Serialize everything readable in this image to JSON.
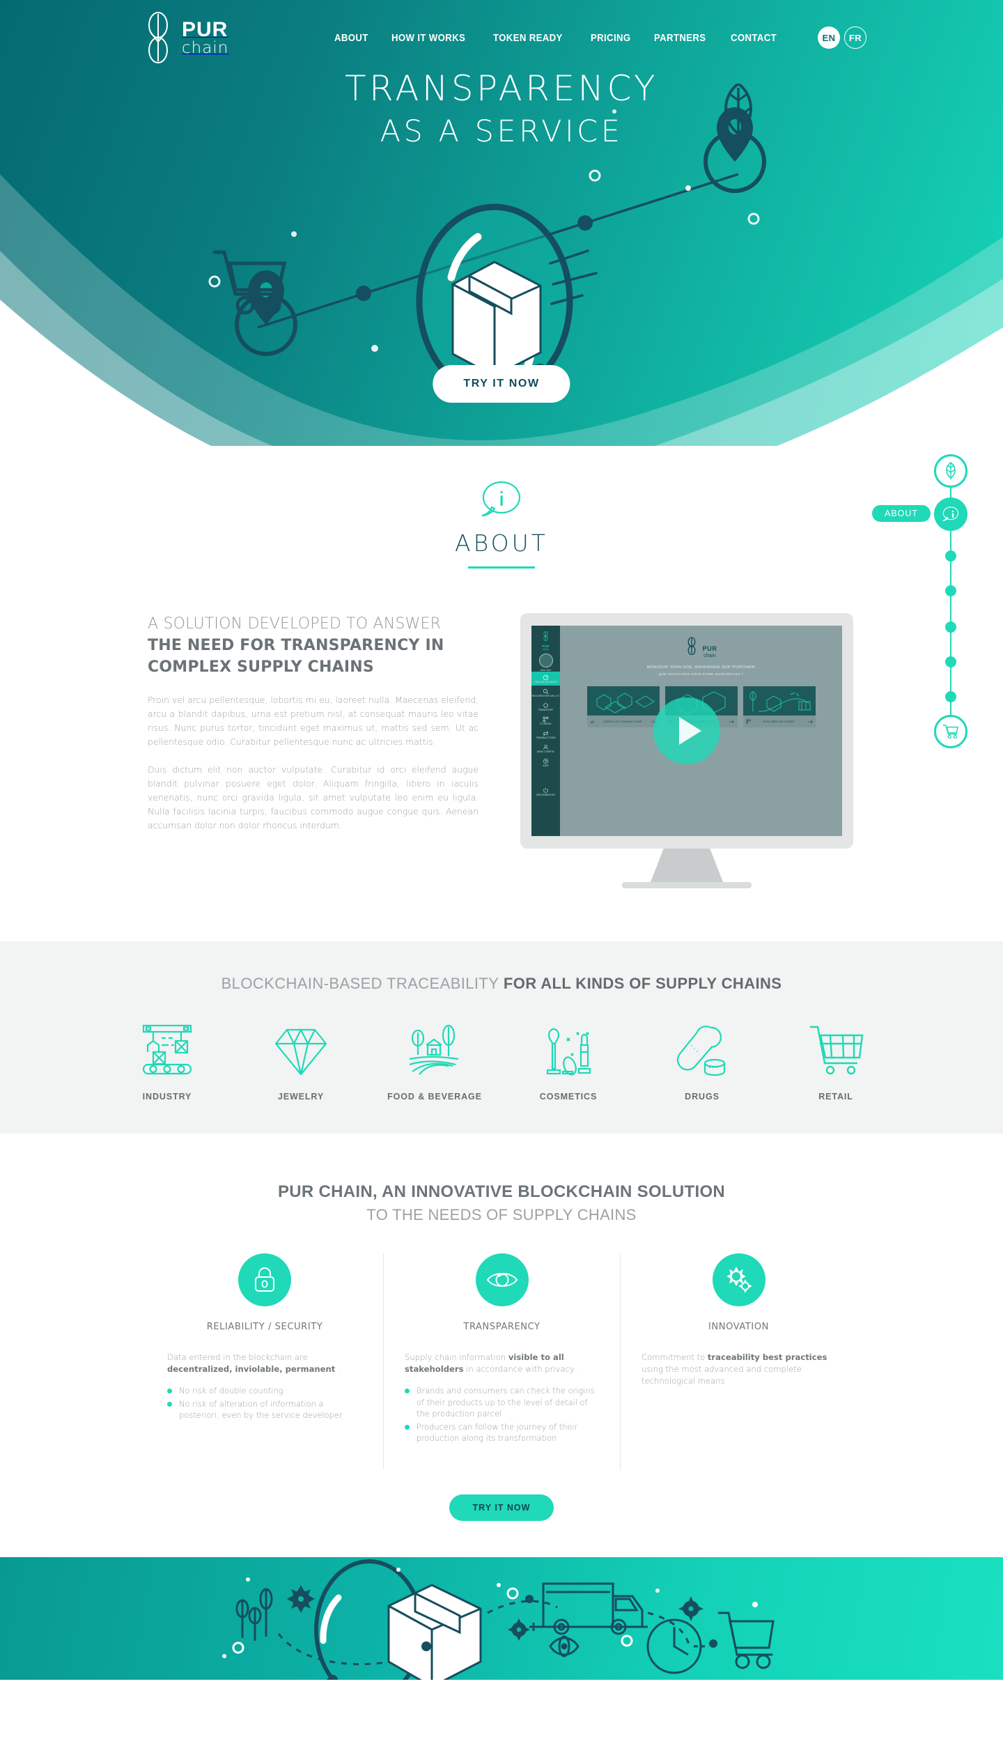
{
  "colors": {
    "accent": "#1fd9b8",
    "hero_dark": "#046a71",
    "hero_light": "#16d6b8",
    "ink": "#15444f",
    "body_text": "#9aa2a6",
    "heading_text": "#6b7276",
    "panel_bg": "#f2f3f3"
  },
  "nav": {
    "logo_top": "PUR",
    "logo_bottom": "chain",
    "logo_icon": "purchain-logo-icon",
    "links": [
      {
        "label": "ABOUT"
      },
      {
        "label": "HOW IT WORKS"
      },
      {
        "label": "TOKEN READY"
      },
      {
        "label": "PRICING"
      },
      {
        "label": "PARTNERS"
      },
      {
        "label": "CONTACT"
      }
    ],
    "languages": [
      {
        "code": "EN",
        "active": true
      },
      {
        "code": "FR",
        "active": false
      }
    ]
  },
  "hero": {
    "title_line1": "TRANSPARENCY",
    "title_line2": "AS A SERVICE",
    "cta_label": "TRY IT NOW",
    "illustration": "magnifying-glass-package-supply-chain"
  },
  "about": {
    "icon": "info-speech-bubble-icon",
    "title": "ABOUT",
    "heading_thin": "A SOLUTION DEVELOPED TO ANSWER",
    "heading_bold": "THE NEED FOR TRANSPARENCY IN COMPLEX SUPPLY CHAINS",
    "paragraph1": "Proin vel arcu pellentesque, lobortis mi eu, laoreet nulla. Maecenas eleifend, arcu a blandit dapibus, urna est pretium nisl, at consequat mauris leo vitae risus. Nunc purus tortor, tincidunt eget maximus ut, mattis sed sem. Ut ac pellentesque odio. Curabitur pellentesque nunc ac ultricies mattis.",
    "paragraph2": "Duis dictum elit non auctor vulputate. Curabitur id orci eleifend augue blandit pulvinar posuere eget dolor.  Aliquam fringilla, libero in iaculis venenatis, nunc orci gravida ligula, sit amet vulputate leo enim eu ligula. Nulla facilisis lacinia turpis, faucibus commodo augue congue quis. Aenean accumsan dolor non dolor rhoncus interdum.",
    "video": {
      "play_label": "play-video",
      "app_logo_top": "PUR",
      "app_logo_bottom": "chain",
      "greeting": "BONJOUR JOHN DOE, BIENVENUE SUR PURCHAIN",
      "subgreeting": "QUE SOUHAITEZ-VOUS FAIRE AUJOURD'HUI ?",
      "user_name": "John Doe",
      "sidebar_items": [
        "TABLEAU DE BORD",
        "RECHERCHER UN LOT",
        "TRANSPORT",
        "FILIÈRES",
        "TRANSACTIONS",
        "MON COMPTE",
        "AIDE",
        "DÉCONNEXION"
      ],
      "cards": [
        {
          "label": "GÉRER LES TRANSACTIONS"
        },
        {
          "label": "RECHERCHER UN LOT"
        },
        {
          "label": "EXPLORER MA FILIÈRE"
        }
      ]
    }
  },
  "scrollnav": {
    "tooltip": "ABOUT",
    "top_icon": "leaf-icon",
    "active_icon": "info-speech-bubble-icon",
    "bottom_icon": "shopping-cart-icon",
    "dot_count": 5
  },
  "traceability": {
    "heading_thin": "BLOCKCHAIN-BASED TRACEABILITY",
    "heading_bold": "FOR ALL KINDS OF SUPPLY CHAINS",
    "items": [
      {
        "label": "INDUSTRY",
        "icon": "factory-conveyor-icon"
      },
      {
        "label": "JEWELRY",
        "icon": "diamond-icon"
      },
      {
        "label": "FOOD & BEVERAGE",
        "icon": "farm-field-icon"
      },
      {
        "label": "COSMETICS",
        "icon": "cosmetics-icon"
      },
      {
        "label": "DRUGS",
        "icon": "pill-capsule-icon"
      },
      {
        "label": "RETAIL",
        "icon": "shopping-cart-icon"
      }
    ]
  },
  "solution": {
    "heading_line1": "PUR CHAIN, AN INNOVATIVE BLOCKCHAIN SOLUTION",
    "heading_line2": "TO THE NEEDS OF SUPPLY CHAINS",
    "cta_label": "TRY IT NOW",
    "columns": [
      {
        "icon": "lock-icon",
        "title": "RELIABILITY / SECURITY",
        "lead_plain": "Data entered in the blockchain are ",
        "lead_bold": "decentralized, inviolable, permanent",
        "lead_tail": " :",
        "bullets": [
          "No risk of double counting",
          "No risk of alteration of information a posteriori, even by the service developer"
        ]
      },
      {
        "icon": "eye-icon",
        "title": "TRANSPARENCY",
        "lead_plain": "Supply chain information ",
        "lead_bold": "visible to all stakeholders",
        "lead_tail": " in accordance with privacy :",
        "bullets": [
          "Brands and consumers can check the origins of their products up to the level of detail of the production parcel",
          "Producers can follow the journey of their production along its transformation"
        ]
      },
      {
        "icon": "gears-icon",
        "title": "INNOVATION",
        "lead_plain": "Commitment to ",
        "lead_bold": "traceability best practices",
        "lead_tail": " using the most advanced and complete technological means",
        "bullets": []
      }
    ]
  },
  "footer_band": {
    "illustration": "supply-chain-magnifier-truck-cart-gears"
  }
}
